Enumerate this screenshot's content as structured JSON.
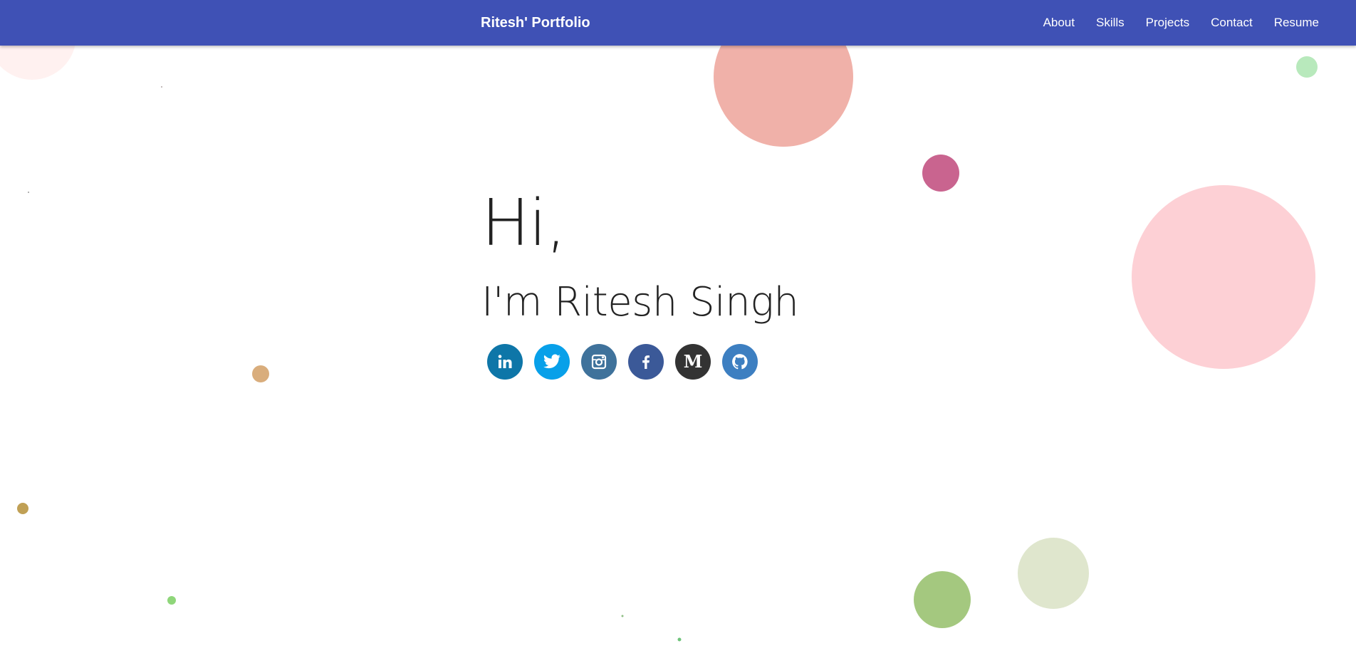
{
  "navbar": {
    "brand": "Ritesh' Portfolio",
    "links": [
      "About",
      "Skills",
      "Projects",
      "Contact",
      "Resume"
    ],
    "background_color": "#3f51b5"
  },
  "hero": {
    "greeting": "Hi,",
    "name": "I'm Ritesh Singh"
  },
  "socials": [
    {
      "network": "LinkedIn",
      "icon": "linkedin-icon",
      "color": "#0e76a8"
    },
    {
      "network": "Twitter",
      "icon": "twitter-icon",
      "color": "#08a0e9"
    },
    {
      "network": "Instagram",
      "icon": "instagram-icon",
      "color": "#3f729b"
    },
    {
      "network": "Facebook",
      "icon": "facebook-icon",
      "color": "#3b5998"
    },
    {
      "network": "Medium",
      "icon": "medium-icon",
      "color": "#333333",
      "glyph": "M"
    },
    {
      "network": "GitHub",
      "icon": "github-icon",
      "color": "#3d7fc1"
    }
  ]
}
